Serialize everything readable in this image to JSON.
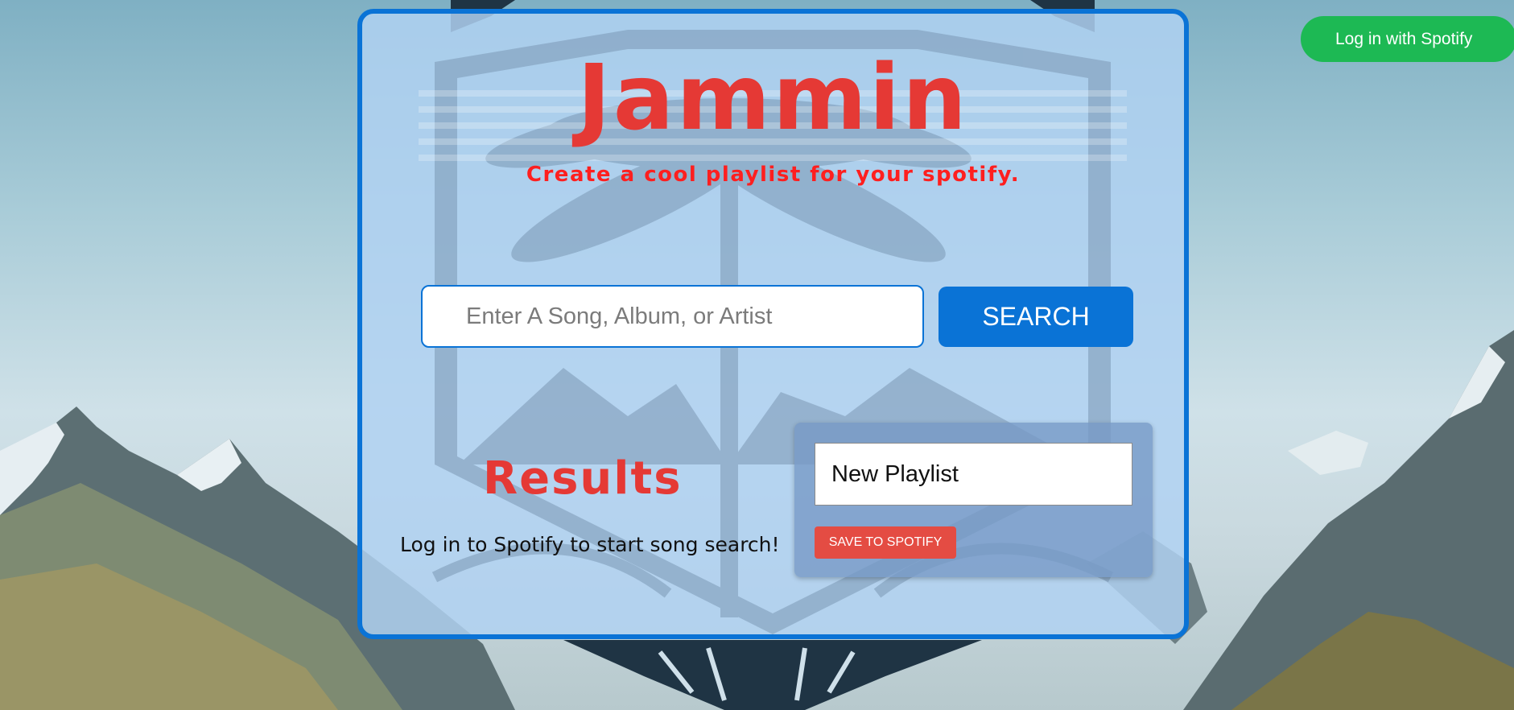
{
  "header": {
    "login_label": "Log in with Spotify"
  },
  "app": {
    "title": "Jammin",
    "subtitle": "Create a cool playlist for your spotify."
  },
  "search": {
    "placeholder": "Enter A Song, Album, or Artist",
    "value": "",
    "button_label": "SEARCH"
  },
  "results": {
    "title": "Results",
    "message": "Log in to Spotify to start song search!"
  },
  "playlist": {
    "name_value": "New Playlist",
    "save_label": "SAVE TO SPOTIFY"
  },
  "colors": {
    "accent_blue": "#0a73d6",
    "title_red": "#e53935",
    "spotify_green": "#1db954",
    "save_red": "#e44c43"
  },
  "icons": [
    "palm-tree-emblem",
    "mountain-background"
  ]
}
